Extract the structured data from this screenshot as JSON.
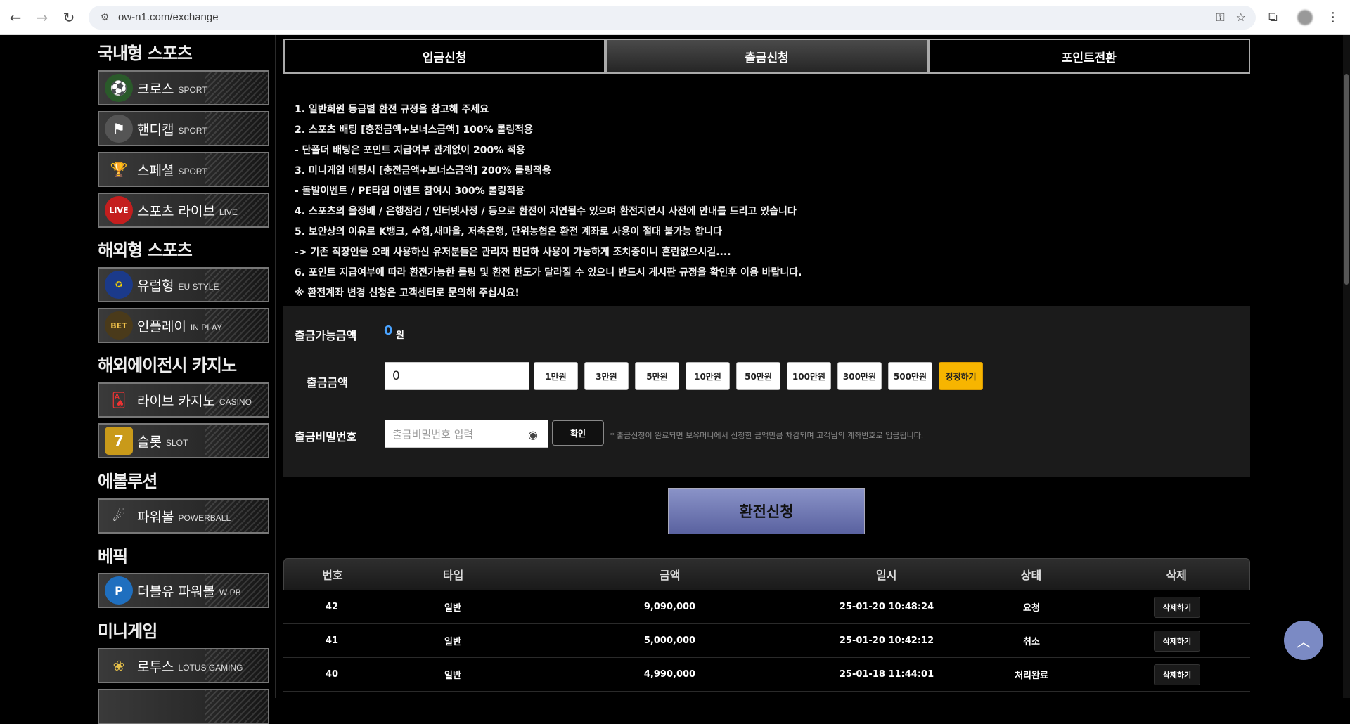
{
  "browser": {
    "url": "ow-n1.com/exchange",
    "icons": [
      "back-icon",
      "forward-icon",
      "reload-icon",
      "key-icon",
      "star-icon",
      "extensions-icon",
      "menu-icon"
    ]
  },
  "sidebar": {
    "categories": [
      {
        "label": "국내형 스포츠"
      },
      {
        "label": "해외형 스포츠"
      },
      {
        "label": "해외에이전시 카지노"
      },
      {
        "label": "에볼루션"
      },
      {
        "label": "베픽"
      },
      {
        "label": "미니게임"
      }
    ],
    "items": [
      {
        "name": "크로스",
        "sub": "SPORT",
        "icon": "soccer-ball-icon"
      },
      {
        "name": "핸디캡",
        "sub": "SPORT",
        "icon": "flag-icon"
      },
      {
        "name": "스페셜",
        "sub": "SPORT",
        "icon": "trophy-icon"
      },
      {
        "name": "스포츠 라이브",
        "sub": "LIVE",
        "icon": "live-icon"
      },
      {
        "name": "유럽형",
        "sub": "EU STYLE",
        "icon": "eu-flag-icon"
      },
      {
        "name": "인플레이",
        "sub": "IN PLAY",
        "icon": "bet-icon"
      },
      {
        "name": "라이브 카지노",
        "sub": "CASINO",
        "icon": "cards-icon"
      },
      {
        "name": "슬롯",
        "sub": "SLOT",
        "icon": "slot-icon"
      },
      {
        "name": "파워볼",
        "sub": "POWERBALL",
        "icon": "powerball-icon"
      },
      {
        "name": "더블유 파워볼",
        "sub": "W PB",
        "icon": "p-icon"
      },
      {
        "name": "로투스",
        "sub": "LOTUS GAMING",
        "icon": "lotus-icon"
      }
    ]
  },
  "tabs": [
    {
      "label": "입금신청"
    },
    {
      "label": "출금신청"
    },
    {
      "label": "포인트전환"
    }
  ],
  "rules": [
    "1. 일반회원 등급별 환전 규정을 참고해 주세요",
    "2. 스포츠 배팅 [충전금액+보너스금액] 100% 롤링적용",
    "- 단폴더 배팅은 포인트 지급여부 관계없이 200% 적용",
    "3. 미니게임 배팅시 [충전금액+보너스금액] 200% 롤링적용",
    "- 돌발이벤트 / PE타임 이벤트 참여시 300% 롤링적용",
    "4. 스포츠의 올정배 / 은행점검 / 인터넷사정 / 등으로 환전이 지연될수 있으며 환전지연시 사전에 안내를 드리고 있습니다",
    "5. 보안상의 이유로 K뱅크, 수협,새마을, 저축은행, 단위농협은 환전 계좌로 사용이 절대 불가능 합니다",
    "-> 기존 직장인을 오래 사용하신 유저분들은 관리자 판단하 사용이 가능하게 조치중이니 혼란없으시길....",
    "6. 포인트 지급여부에 따라 환전가능한 롤링 및 환전 한도가 달라질 수 있으니 반드시 게시판 규정을 확인후 이용 바랍니다.",
    "※ 환전계좌 변경 신청은 고객센터로 문의해 주십시요!"
  ],
  "form": {
    "available_label": "출금가능금액",
    "available_value": "0",
    "available_unit": "원",
    "amount_label": "출금금액",
    "amount_value": "0",
    "quick_amounts": [
      "1만원",
      "3만원",
      "5만원",
      "10만원",
      "50만원",
      "100만원",
      "300만원",
      "500만원"
    ],
    "reset_label": "정정하기",
    "password_label": "출금비밀번호",
    "password_placeholder": "출금비밀번호 입력",
    "confirm_label": "확인",
    "notice": "* 출금신청이 완료되면 보유머니에서 신청한 금액만큼 차감되며 고객님의 계좌번호로 입금됩니다."
  },
  "submit_label": "환전신청",
  "table": {
    "headers": [
      "번호",
      "타입",
      "금액",
      "일시",
      "상태",
      "삭제"
    ],
    "rows": [
      {
        "no": "42",
        "type": "일반",
        "amount": "9,090,000",
        "date": "25-01-20 10:48:24",
        "status": "요청",
        "action": "삭제하기"
      },
      {
        "no": "41",
        "type": "일반",
        "amount": "5,000,000",
        "date": "25-01-20 10:42:12",
        "status": "취소",
        "action": "삭제하기"
      },
      {
        "no": "40",
        "type": "일반",
        "amount": "4,990,000",
        "date": "25-01-18 11:44:01",
        "status": "처리완료",
        "action": "삭제하기"
      }
    ]
  },
  "colors": {
    "accent": "#f7b500",
    "submit": "#6f78b5",
    "available": "#4aa3ff"
  }
}
